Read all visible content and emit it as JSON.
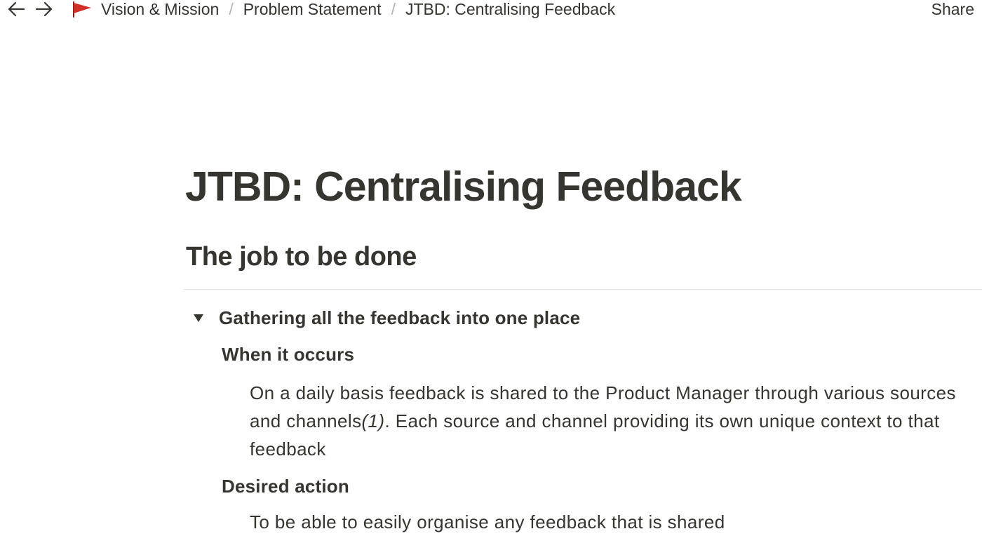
{
  "topbar": {
    "breadcrumbs": [
      {
        "label": "Vision & Mission",
        "icon": "red-flag-icon"
      },
      {
        "label": "Problem Statement"
      },
      {
        "label": "JTBD: Centralising Feedback"
      }
    ],
    "separator": "/",
    "share_label": "Share"
  },
  "page": {
    "title": "JTBD: Centralising Feedback",
    "section_heading": "The job to be done",
    "toggle": {
      "label": "Gathering all the feedback into one place",
      "expanded": true,
      "when_heading": "When it occurs",
      "when_text_line1": "On a daily basis feedback is shared to the Product Manager through various sources",
      "when_text_line2_start": "and channels",
      "when_text_line2_ref": "(1)",
      "when_text_line2_end": ". Each source and channel providing its own unique context to that",
      "when_text_line3": "feedback",
      "desired_heading": "Desired action",
      "desired_text": "To be able to easily organise any feedback that is shared"
    }
  },
  "colors": {
    "text": "#37352f",
    "flag": "#d0302a",
    "divider": "#e6e6e4"
  }
}
